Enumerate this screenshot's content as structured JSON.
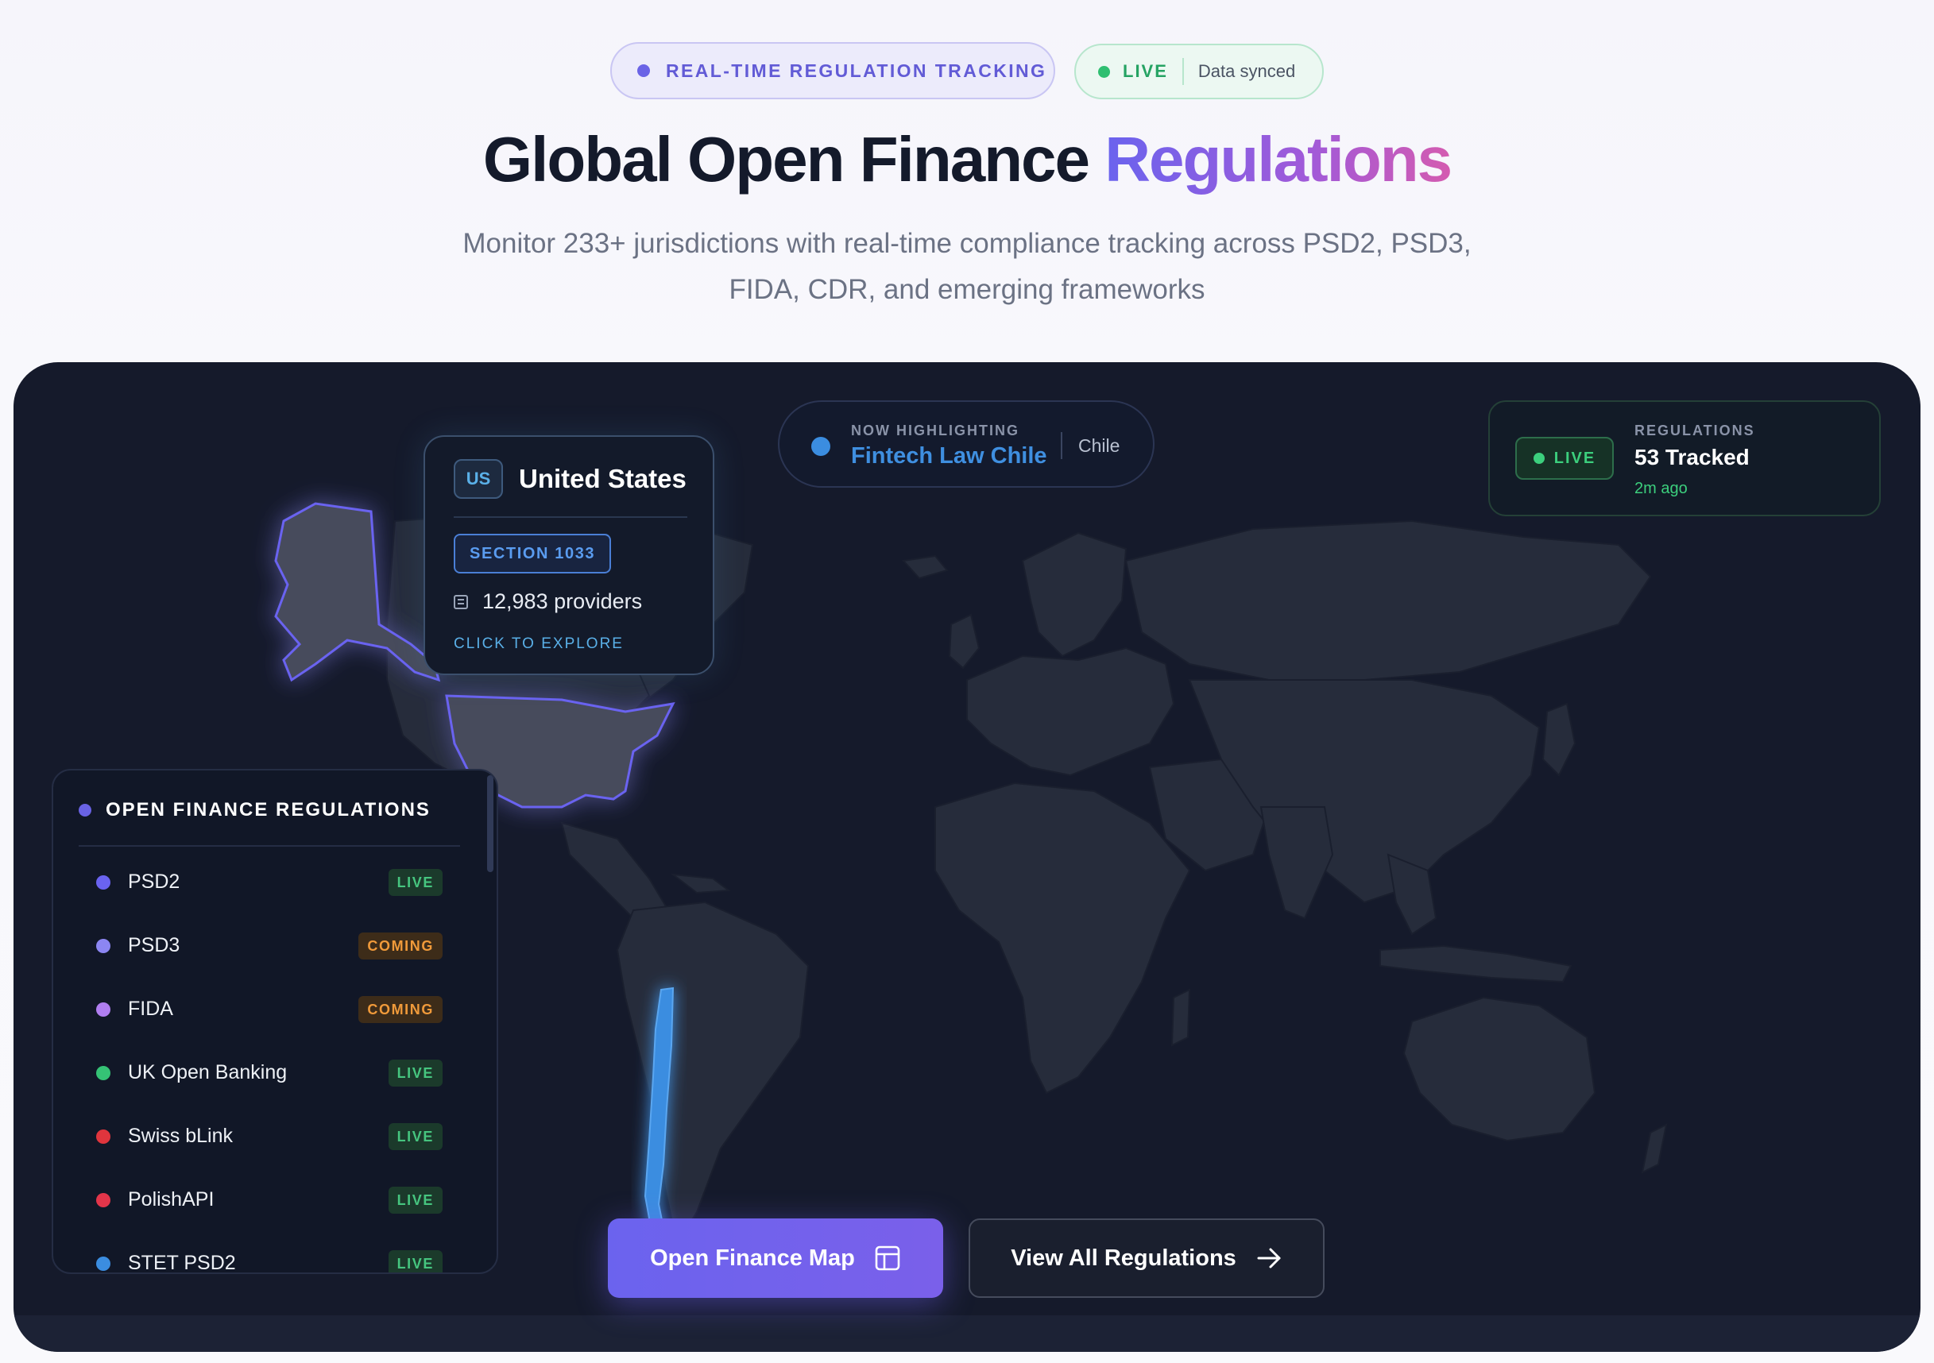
{
  "hero": {
    "tracking_badge": "REAL-TIME REGULATION TRACKING",
    "live_badge": "LIVE",
    "sync_status": "Data synced",
    "title_main": "Global Open Finance ",
    "title_accent": "Regulations",
    "subtitle_line1": "Monitor 233+ jurisdictions with real-time compliance tracking across PSD2, PSD3,",
    "subtitle_line2": "FIDA, CDR, and emerging frameworks"
  },
  "tooltip": {
    "country_code": "US",
    "country_name": "United States",
    "section": "SECTION 1033",
    "providers": "12,983 providers",
    "cta": "CLICK TO EXPLORE"
  },
  "now_highlighting": {
    "label": "NOW HIGHLIGHTING",
    "regulation": "Fintech Law Chile",
    "country": "Chile"
  },
  "counter": {
    "live": "LIVE",
    "label": "REGULATIONS",
    "value": "53 Tracked",
    "updated": "2m ago"
  },
  "sidebar": {
    "title": "OPEN FINANCE REGULATIONS",
    "items": [
      {
        "label": "PSD2",
        "status": "LIVE",
        "dot": "#6a63f0"
      },
      {
        "label": "PSD3",
        "status": "COMING",
        "dot": "#8c86f2"
      },
      {
        "label": "FIDA",
        "status": "COMING",
        "dot": "#b07ef0"
      },
      {
        "label": "UK Open Banking",
        "status": "LIVE",
        "dot": "#35c275"
      },
      {
        "label": "Swiss bLink",
        "status": "LIVE",
        "dot": "#e0353d"
      },
      {
        "label": "PolishAPI",
        "status": "LIVE",
        "dot": "#e3354a"
      },
      {
        "label": "STET PSD2",
        "status": "LIVE",
        "dot": "#3b8de0"
      }
    ]
  },
  "buttons": {
    "primary": "Open Finance Map",
    "secondary": "View All Regulations"
  },
  "colors": {
    "accent": "#6b63ee",
    "highlight_blue": "#3b8de0",
    "live_green": "#3ccf7d",
    "coming_orange": "#f09a3a",
    "panel_bg": "#151a2b"
  }
}
